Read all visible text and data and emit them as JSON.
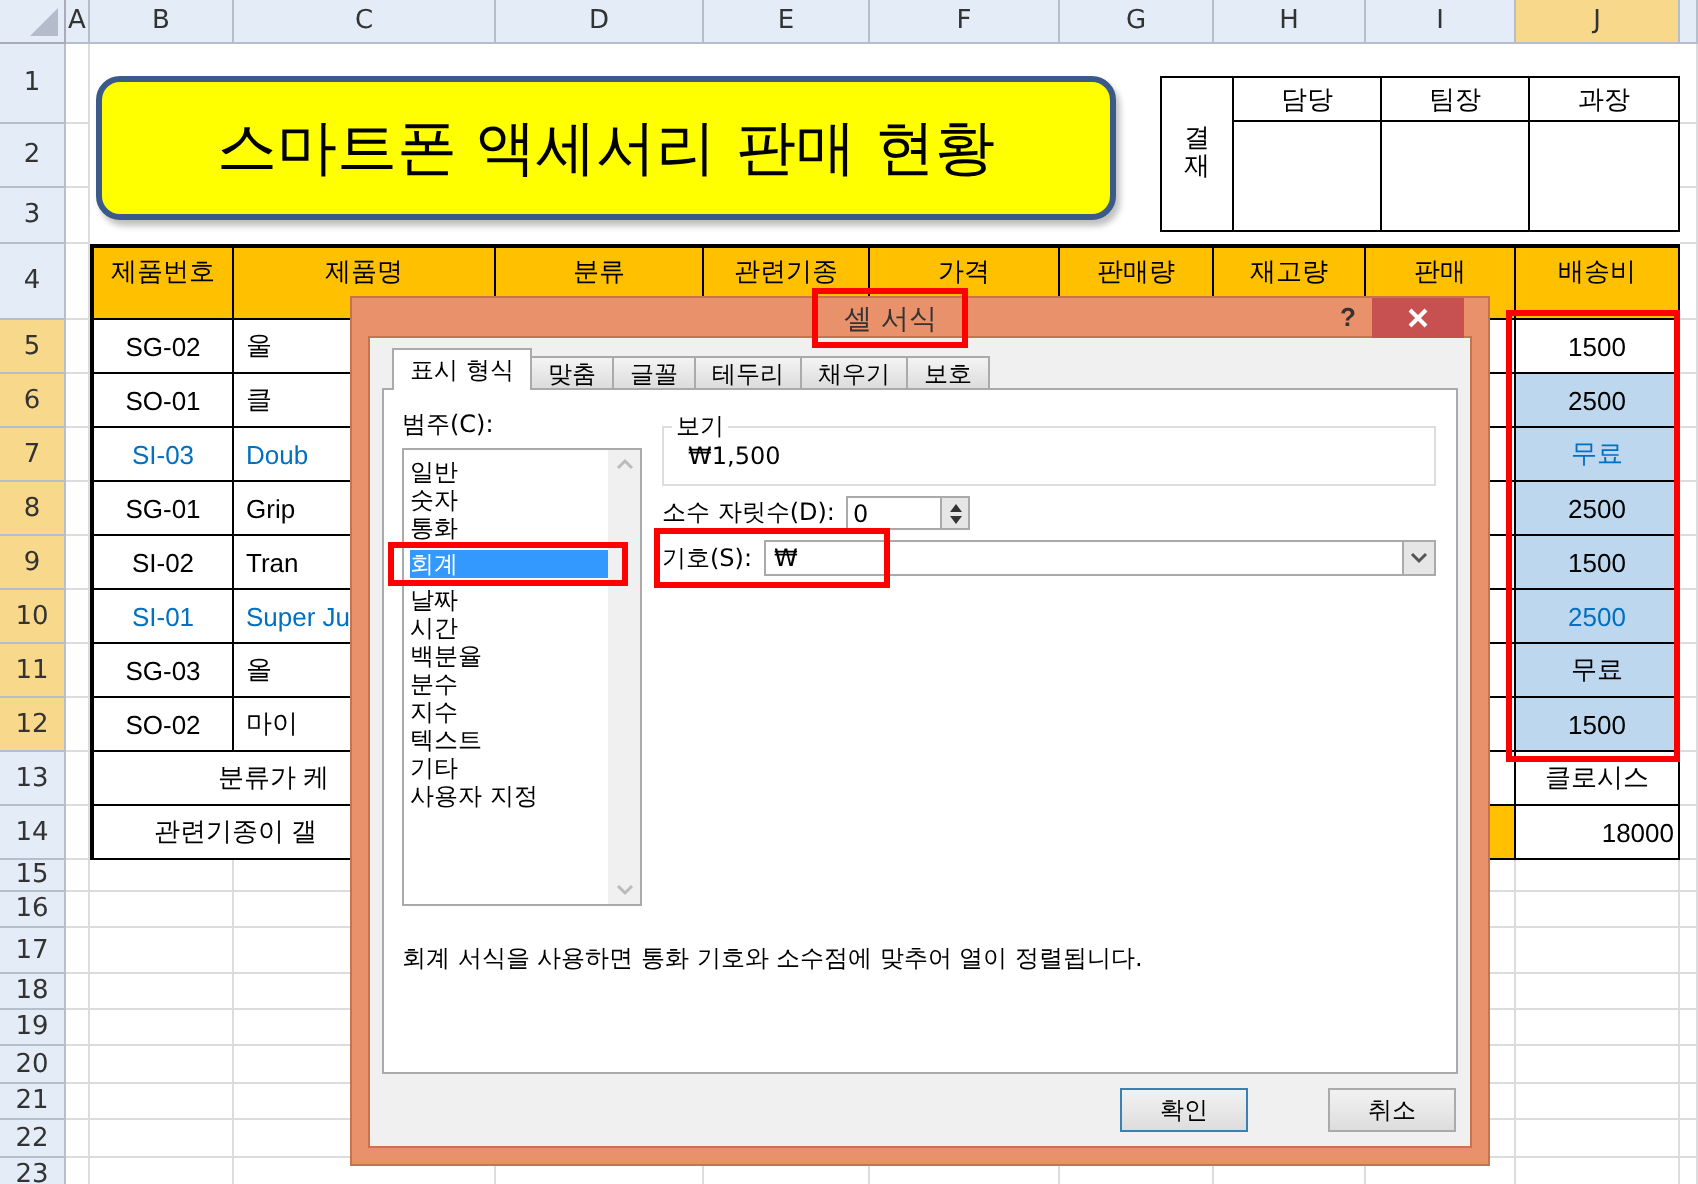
{
  "columns": [
    {
      "label": "A",
      "selected": false
    },
    {
      "label": "B",
      "selected": false
    },
    {
      "label": "C",
      "selected": false
    },
    {
      "label": "D",
      "selected": false
    },
    {
      "label": "E",
      "selected": false
    },
    {
      "label": "F",
      "selected": false
    },
    {
      "label": "G",
      "selected": false
    },
    {
      "label": "H",
      "selected": false
    },
    {
      "label": "I",
      "selected": false
    },
    {
      "label": "J",
      "selected": true
    }
  ],
  "rows": [
    {
      "label": "1",
      "selected": false
    },
    {
      "label": "2",
      "selected": false
    },
    {
      "label": "3",
      "selected": false
    },
    {
      "label": "4",
      "selected": false
    },
    {
      "label": "5",
      "selected": true
    },
    {
      "label": "6",
      "selected": true
    },
    {
      "label": "7",
      "selected": true
    },
    {
      "label": "8",
      "selected": true
    },
    {
      "label": "9",
      "selected": true
    },
    {
      "label": "10",
      "selected": true
    },
    {
      "label": "11",
      "selected": true
    },
    {
      "label": "12",
      "selected": true
    },
    {
      "label": "13",
      "selected": false
    },
    {
      "label": "14",
      "selected": false
    },
    {
      "label": "15",
      "selected": false
    },
    {
      "label": "16",
      "selected": false
    },
    {
      "label": "17",
      "selected": false
    },
    {
      "label": "18",
      "selected": false
    },
    {
      "label": "19",
      "selected": false
    },
    {
      "label": "20",
      "selected": false
    },
    {
      "label": "21",
      "selected": false
    },
    {
      "label": "22",
      "selected": false
    },
    {
      "label": "23",
      "selected": false
    }
  ],
  "title": "스마트폰 액세서리 판매 현황",
  "approval": {
    "side": "결재",
    "headers": [
      "담당",
      "팀장",
      "과장"
    ]
  },
  "table": {
    "header": [
      "제품번호",
      "제품명",
      "분류",
      "관련기종",
      "가격",
      "판매량",
      "재고량",
      "판매",
      "배송비"
    ],
    "rows": [
      {
        "code": "SG-02",
        "name": "울",
        "fee": "1500",
        "highlighted": false,
        "selected": true,
        "active": true
      },
      {
        "code": "SO-01",
        "name": "클",
        "fee": "2500",
        "highlighted": false,
        "selected": true,
        "active": false
      },
      {
        "code": "SI-03",
        "name": "Doub",
        "fee": "무료",
        "highlighted": true,
        "selected": true,
        "active": false
      },
      {
        "code": "SG-01",
        "name": "Grip",
        "fee": "2500",
        "highlighted": false,
        "selected": true,
        "active": false
      },
      {
        "code": "SI-02",
        "name": "Tran",
        "fee": "1500",
        "highlighted": false,
        "selected": true,
        "active": false
      },
      {
        "code": "SI-01",
        "name": "Super Ju",
        "fee": "2500",
        "highlighted": true,
        "selected": true,
        "active": false
      },
      {
        "code": "SG-03",
        "name": "올",
        "fee": "무료",
        "highlighted": false,
        "selected": true,
        "active": false
      },
      {
        "code": "SO-02",
        "name": "마이",
        "fee": "1500",
        "highlighted": false,
        "selected": true,
        "active": false
      }
    ],
    "summary": [
      {
        "label": "분류가 케",
        "value": "클로시스"
      },
      {
        "label": "관련기종이 갤",
        "value": "18000"
      }
    ]
  },
  "dialog": {
    "title": "셀 서식",
    "help": "?",
    "tabs": [
      {
        "label": "표시 형식",
        "selected": true
      },
      {
        "label": "맞춤",
        "selected": false
      },
      {
        "label": "글꼴",
        "selected": false
      },
      {
        "label": "테두리",
        "selected": false
      },
      {
        "label": "채우기",
        "selected": false
      },
      {
        "label": "보호",
        "selected": false
      }
    ],
    "category_label": "범주(C):",
    "categories": [
      {
        "label": "일반",
        "selected": false
      },
      {
        "label": "숫자",
        "selected": false
      },
      {
        "label": "통화",
        "selected": false
      },
      {
        "label": "회계",
        "selected": true
      },
      {
        "label": "날짜",
        "selected": false
      },
      {
        "label": "시간",
        "selected": false
      },
      {
        "label": "백분율",
        "selected": false
      },
      {
        "label": "분수",
        "selected": false
      },
      {
        "label": "지수",
        "selected": false
      },
      {
        "label": "텍스트",
        "selected": false
      },
      {
        "label": "기타",
        "selected": false
      },
      {
        "label": "사용자 지정",
        "selected": false
      }
    ],
    "preview_label": "보기",
    "preview": "₩1,500",
    "decimals_label": "소수 자릿수(D):",
    "decimals": "0",
    "symbol_label": "기호(S):",
    "symbol": "₩",
    "description": "회계 서식을 사용하면 통화 기호와 소수점에 맞추어 열이 정렬됩니다.",
    "buttons": [
      "확인",
      "취소"
    ]
  }
}
